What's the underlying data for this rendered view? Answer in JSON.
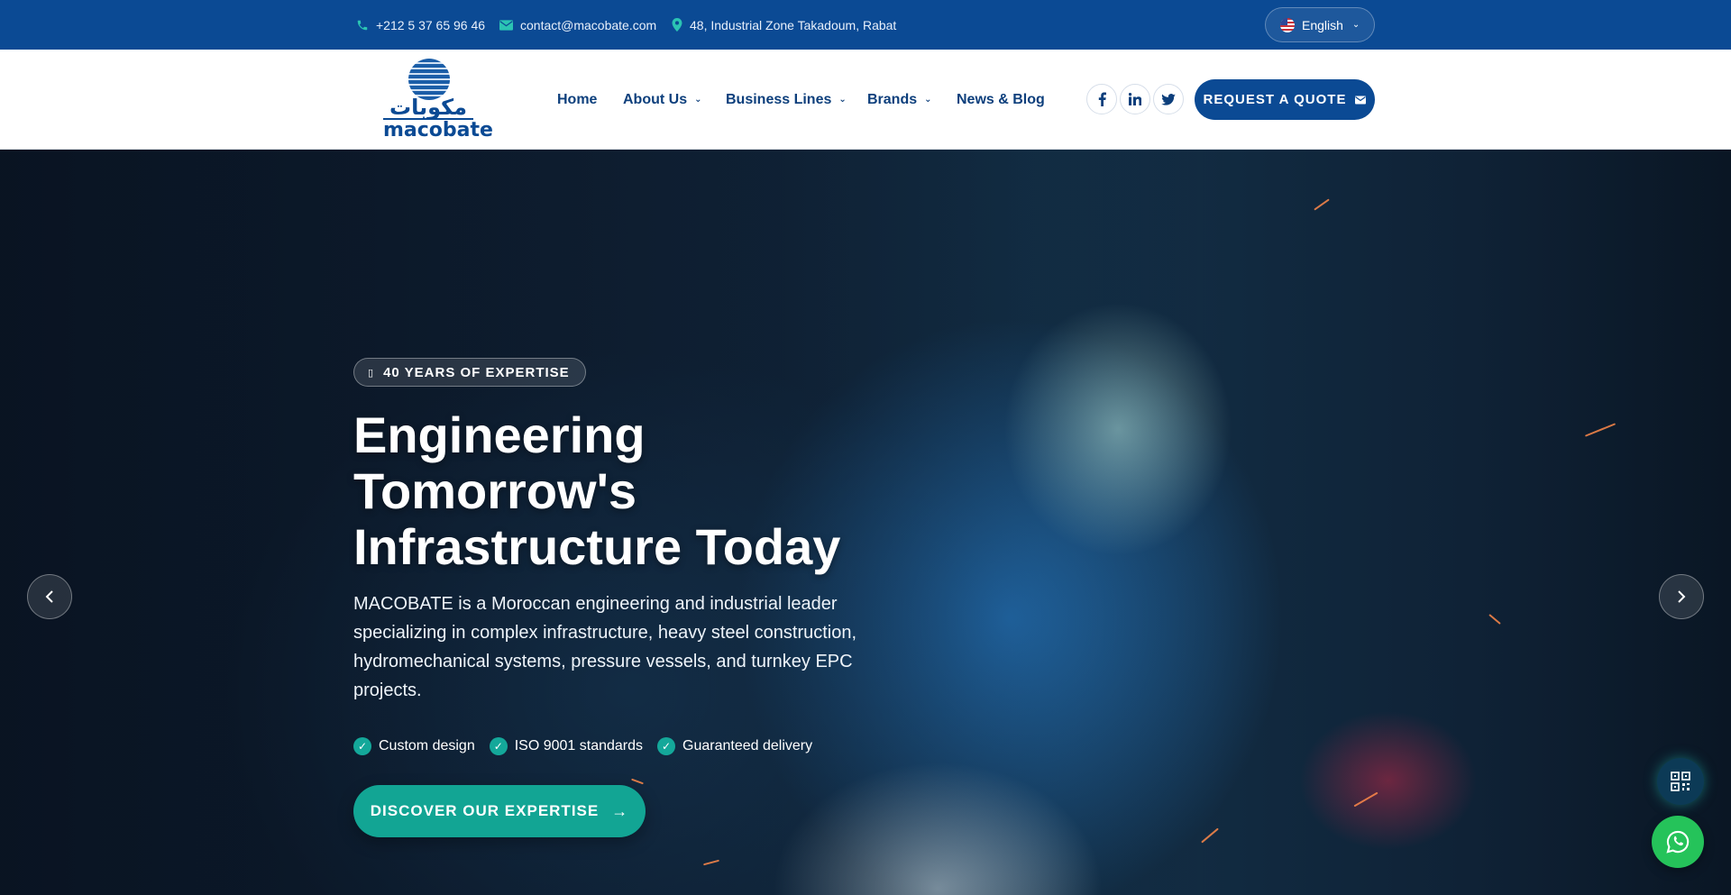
{
  "topbar": {
    "phone": "+212 5 37 65 96 46",
    "email": "contact@macobate.com",
    "address": "48, Industrial Zone Takadoum, Rabat",
    "language": "English"
  },
  "header": {
    "logo_arabic": "مكوبات",
    "logo_text": "macobate",
    "nav": [
      "Home",
      "About Us",
      "Business Lines",
      "Brands",
      "News & Blog"
    ],
    "quote_button": "REQUEST A QUOTE"
  },
  "hero": {
    "badge": "40 YEARS OF EXPERTISE",
    "title_lines": [
      "Engineering",
      "Tomorrow's",
      "Infrastructure Today"
    ],
    "description": "MACOBATE is a Moroccan engineering and industrial leader specializing in complex infrastructure, heavy steel construction, hydromechanical systems, pressure vessels, and turnkey EPC projects.",
    "features": [
      "Custom design",
      "ISO 9001 standards",
      "Guaranteed delivery"
    ],
    "cta": "DISCOVER OUR EXPERTISE"
  },
  "colors": {
    "primary": "#0b4a94",
    "accent": "#12a594",
    "whatsapp": "#25c35a"
  },
  "icons": [
    "phone-icon",
    "mail-icon",
    "map-pin-icon",
    "facebook-icon",
    "linkedin-icon",
    "twitter-icon",
    "chevron-left-icon",
    "chevron-right-icon",
    "qr-code-icon",
    "whatsapp-icon"
  ]
}
